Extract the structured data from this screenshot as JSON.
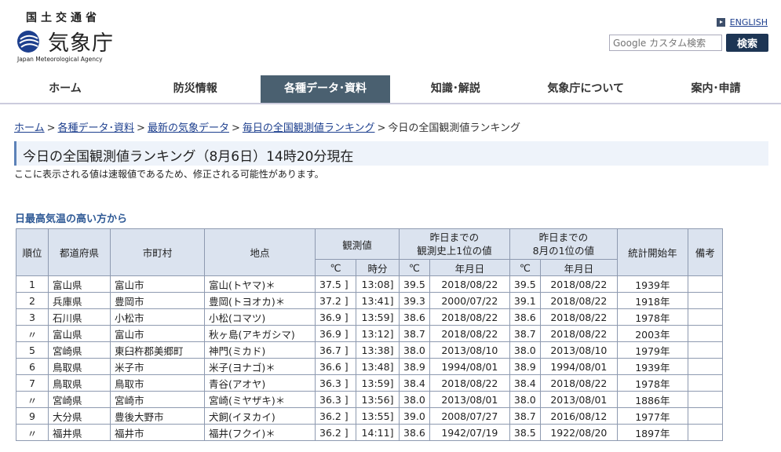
{
  "header": {
    "ministry": "国土交通省",
    "agency": "気象庁",
    "agency_en": "Japan Meteorological Agency",
    "english_link": "ENGLISH",
    "search_placeholder": "Google カスタム検索",
    "search_button": "検索"
  },
  "nav": [
    {
      "label": "ホーム",
      "active": false
    },
    {
      "label": "防災情報",
      "active": false
    },
    {
      "label": "各種データ･資料",
      "active": true
    },
    {
      "label": "知識･解説",
      "active": false
    },
    {
      "label": "気象庁について",
      "active": false
    },
    {
      "label": "案内･申請",
      "active": false
    }
  ],
  "breadcrumb": [
    "ホーム",
    "各種データ･資料",
    "最新の気象データ",
    "毎日の全国観測値ランキング",
    "今日の全国観測値ランキング"
  ],
  "page_title": "今日の全国観測値ランキング（8月6日）14時20分現在",
  "notice": "ここに表示される値は速報値であるため、修正される可能性があります。",
  "section_title": "日最高気温の高い方から",
  "table": {
    "headers": {
      "rank": "順位",
      "pref": "都道府県",
      "city": "市町村",
      "station": "地点",
      "obs": "観測値",
      "record": "昨日までの\n観測史上1位の値",
      "month": "昨日までの\n8月の1位の値",
      "start": "統計開始年",
      "note": "備考",
      "celsius": "℃",
      "time": "時分",
      "date": "年月日"
    },
    "rows": [
      {
        "rank": "1",
        "pref": "富山県",
        "city": "富山市",
        "station": "富山(トヤマ)＊",
        "val": "37.5 ]",
        "time": "13:08]",
        "rec": "39.5",
        "rec_date": "2018/08/22",
        "mon": "39.5",
        "mon_date": "2018/08/22",
        "start": "1939年",
        "note": ""
      },
      {
        "rank": "2",
        "pref": "兵庫県",
        "city": "豊岡市",
        "station": "豊岡(トヨオカ)＊",
        "val": "37.2 ]",
        "time": "13:41]",
        "rec": "39.3",
        "rec_date": "2000/07/22",
        "mon": "39.1",
        "mon_date": "2018/08/22",
        "start": "1918年",
        "note": ""
      },
      {
        "rank": "3",
        "pref": "石川県",
        "city": "小松市",
        "station": "小松(コマツ)",
        "val": "36.9 ]",
        "time": "13:59]",
        "rec": "38.6",
        "rec_date": "2018/08/22",
        "mon": "38.6",
        "mon_date": "2018/08/22",
        "start": "1978年",
        "note": ""
      },
      {
        "rank": "〃",
        "pref": "富山県",
        "city": "富山市",
        "station": "秋ヶ島(アキガシマ)",
        "val": "36.9 ]",
        "time": "13:12]",
        "rec": "38.7",
        "rec_date": "2018/08/22",
        "mon": "38.7",
        "mon_date": "2018/08/22",
        "start": "2003年",
        "note": ""
      },
      {
        "rank": "5",
        "pref": "宮崎県",
        "city": "東臼杵郡美郷町",
        "station": "神門(ミカド)",
        "val": "36.7 ]",
        "time": "13:38]",
        "rec": "38.0",
        "rec_date": "2013/08/10",
        "mon": "38.0",
        "mon_date": "2013/08/10",
        "start": "1979年",
        "note": ""
      },
      {
        "rank": "6",
        "pref": "鳥取県",
        "city": "米子市",
        "station": "米子(ヨナゴ)＊",
        "val": "36.6 ]",
        "time": "13:48]",
        "rec": "38.9",
        "rec_date": "1994/08/01",
        "mon": "38.9",
        "mon_date": "1994/08/01",
        "start": "1939年",
        "note": ""
      },
      {
        "rank": "7",
        "pref": "鳥取県",
        "city": "鳥取市",
        "station": "青谷(アオヤ)",
        "val": "36.3 ]",
        "time": "13:59]",
        "rec": "38.4",
        "rec_date": "2018/08/22",
        "mon": "38.4",
        "mon_date": "2018/08/22",
        "start": "1978年",
        "note": ""
      },
      {
        "rank": "〃",
        "pref": "宮崎県",
        "city": "宮崎市",
        "station": "宮崎(ミヤザキ)＊",
        "val": "36.3 ]",
        "time": "13:56]",
        "rec": "38.0",
        "rec_date": "2013/08/01",
        "mon": "38.0",
        "mon_date": "2013/08/01",
        "start": "1886年",
        "note": ""
      },
      {
        "rank": "9",
        "pref": "大分県",
        "city": "豊後大野市",
        "station": "犬飼(イヌカイ)",
        "val": "36.2 ]",
        "time": "13:55]",
        "rec": "39.0",
        "rec_date": "2008/07/27",
        "mon": "38.7",
        "mon_date": "2016/08/12",
        "start": "1977年",
        "note": ""
      },
      {
        "rank": "〃",
        "pref": "福井県",
        "city": "福井市",
        "station": "福井(フクイ)＊",
        "val": "36.2 ]",
        "time": "14:11]",
        "rec": "38.6",
        "rec_date": "1942/07/19",
        "mon": "38.5",
        "mon_date": "1922/08/20",
        "start": "1897年",
        "note": ""
      }
    ]
  }
}
